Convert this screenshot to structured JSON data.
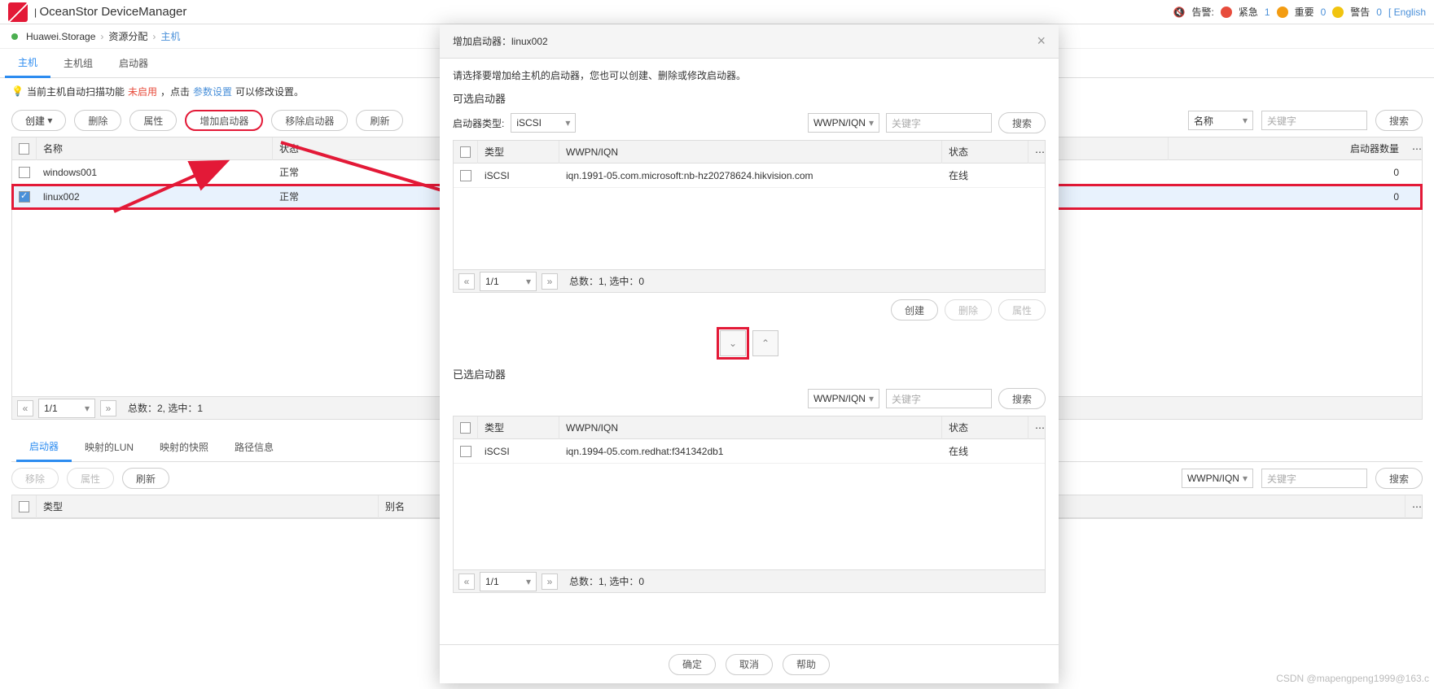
{
  "header": {
    "appname": "OceanStor DeviceManager",
    "alarm_label": "告警:",
    "critical_label": "紧急",
    "critical_count": "1",
    "major_label": "重要",
    "major_count": "0",
    "warning_label": "警告",
    "warning_count": "0",
    "lang": "[ English"
  },
  "crumb": {
    "root": "Huawei.Storage",
    "lvl1": "资源分配",
    "lvl2": "主机"
  },
  "tabs": {
    "host": "主机",
    "hostgroup": "主机组",
    "initiator": "启动器"
  },
  "tip": {
    "t1": "当前主机自动扫描功能 ",
    "t2": "未启用",
    "t3": " ，点击 ",
    "t4": "参数设置 ",
    "t5": "可以修改设置。"
  },
  "toolbar": {
    "create": "创建",
    "delete": "删除",
    "props": "属性",
    "add_init": "增加启动器",
    "rem_init": "移除启动器",
    "refresh": "刷新",
    "filter": "名称",
    "ph": "关键字",
    "search": "搜索"
  },
  "grid": {
    "col_name": "名称",
    "col_status": "状态",
    "col_initcount": "启动器数量",
    "rows": [
      {
        "name": "windows001",
        "status": "正常",
        "count": "0"
      },
      {
        "name": "linux002",
        "status": "正常",
        "count": "0"
      }
    ]
  },
  "pager": {
    "page": "1/1",
    "total": "总数：2,  选中：1"
  },
  "subtabs": {
    "init": "启动器",
    "lun": "映射的LUN",
    "snap": "映射的快照",
    "path": "路径信息"
  },
  "subtb": {
    "remove": "移除",
    "props": "属性",
    "refresh": "刷新",
    "filter": "WWPN/IQN",
    "ph": "关键字",
    "search": "搜索"
  },
  "subgrid": {
    "col_type": "类型",
    "col_alias": "别名"
  },
  "modal": {
    "title": "增加启动器：linux002",
    "desc": "请选择要增加给主机的启动器，您也可以创建、删除或修改启动器。",
    "avail_title": "可选启动器",
    "type_label": "启动器类型:",
    "type_value": "iSCSI",
    "filter": "WWPN/IQN",
    "ph": "关键字",
    "search": "搜索",
    "col_type": "类型",
    "col_wwpn": "WWPN/IQN",
    "col_status": "状态",
    "avail_rows": [
      {
        "type": "iSCSI",
        "wwpn": "iqn.1991-05.com.microsoft:nb-hz20278624.hikvision.com",
        "status": "在线"
      }
    ],
    "avail_pager": {
      "page": "1/1",
      "total": "总数：1,  选中：0"
    },
    "create": "创建",
    "delete": "删除",
    "props": "属性",
    "selected_title": "已选启动器",
    "sel_rows": [
      {
        "type": "iSCSI",
        "wwpn": "iqn.1994-05.com.redhat:f341342db1",
        "status": "在线"
      }
    ],
    "sel_pager": {
      "page": "1/1",
      "total": "总数：1,  选中：0"
    },
    "ok": "确定",
    "cancel": "取消",
    "help": "帮助"
  },
  "watermark": "CSDN @mapengpeng1999@163.c"
}
